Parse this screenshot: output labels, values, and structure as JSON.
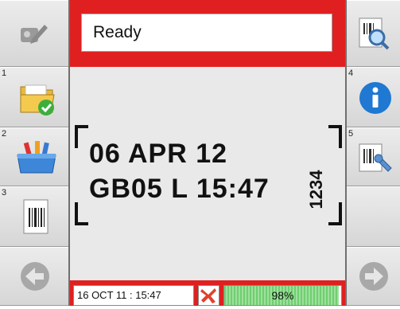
{
  "status": {
    "text": "Ready"
  },
  "print_preview": {
    "line1": "06 APR 12",
    "line2": "GB05 L 15:47",
    "vertical_code": "1234"
  },
  "left_buttons": [
    {
      "number": "",
      "icon": "edit-disabled-icon"
    },
    {
      "number": "1",
      "icon": "folder-check-icon"
    },
    {
      "number": "2",
      "icon": "toolbox-icon"
    },
    {
      "number": "3",
      "icon": "barcode-document-icon"
    },
    {
      "number": "",
      "icon": "back-arrow-icon"
    }
  ],
  "right_buttons": [
    {
      "number": "",
      "icon": "preview-magnifier-icon"
    },
    {
      "number": "4",
      "icon": "info-icon"
    },
    {
      "number": "5",
      "icon": "barcode-wrench-icon"
    },
    {
      "number": "",
      "icon": "blank"
    },
    {
      "number": "",
      "icon": "forward-arrow-icon"
    }
  ],
  "footer": {
    "datetime": "16 OCT 11 : 15:47",
    "alert_icon": "x-alert-icon",
    "level_percent": 98,
    "level_label": "98%"
  },
  "colors": {
    "accent_red": "#e02020",
    "level_green": "#6fcf6f",
    "info_blue": "#1f78d1"
  }
}
